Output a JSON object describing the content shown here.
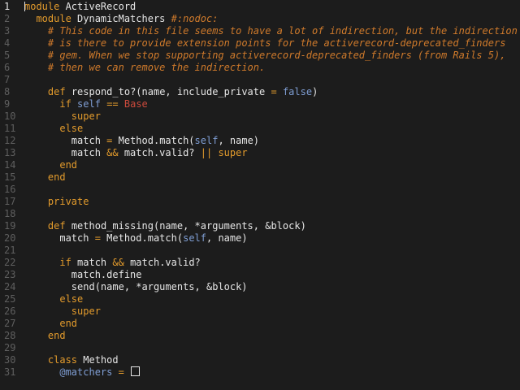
{
  "editor": {
    "current_line": 1,
    "colors": {
      "background": "#1c1c1c",
      "plain": "#e6e6e6",
      "keyword": "#e39b2c",
      "comment": "#cf7a2b",
      "constant": "#cc4a3c",
      "ivar": "#7f9ed4",
      "linenumber": "#5f5f5f",
      "linenumber_current": "#e6e6e6"
    },
    "lines": [
      {
        "n": "1",
        "tokens": [
          [
            "keyword",
            "module"
          ],
          [
            "plain",
            " ActiveRecord"
          ]
        ]
      },
      {
        "n": "2",
        "tokens": [
          [
            "plain",
            "  "
          ],
          [
            "keyword",
            "module"
          ],
          [
            "plain",
            " DynamicMatchers "
          ],
          [
            "comment",
            "#:nodoc:"
          ]
        ]
      },
      {
        "n": "3",
        "tokens": [
          [
            "plain",
            "    "
          ],
          [
            "comment",
            "# This code in this file seems to have a lot of indirection, but the indirection"
          ]
        ]
      },
      {
        "n": "4",
        "tokens": [
          [
            "plain",
            "    "
          ],
          [
            "comment",
            "# is there to provide extension points for the activerecord-deprecated_finders"
          ]
        ]
      },
      {
        "n": "5",
        "tokens": [
          [
            "plain",
            "    "
          ],
          [
            "comment",
            "# gem. When we stop supporting activerecord-deprecated_finders (from Rails 5),"
          ]
        ]
      },
      {
        "n": "6",
        "tokens": [
          [
            "plain",
            "    "
          ],
          [
            "comment",
            "# then we can remove the indirection."
          ]
        ]
      },
      {
        "n": "7",
        "tokens": []
      },
      {
        "n": "8",
        "tokens": [
          [
            "plain",
            "    "
          ],
          [
            "keyword",
            "def"
          ],
          [
            "plain",
            " respond_to?(name, include_private "
          ],
          [
            "keyword",
            "="
          ],
          [
            "plain",
            " "
          ],
          [
            "ivar",
            "false"
          ],
          [
            "plain",
            ")"
          ]
        ]
      },
      {
        "n": "9",
        "tokens": [
          [
            "plain",
            "      "
          ],
          [
            "keyword",
            "if"
          ],
          [
            "plain",
            " "
          ],
          [
            "ivar",
            "self"
          ],
          [
            "plain",
            " "
          ],
          [
            "keyword",
            "=="
          ],
          [
            "plain",
            " "
          ],
          [
            "constant",
            "Base"
          ]
        ]
      },
      {
        "n": "10",
        "tokens": [
          [
            "plain",
            "        "
          ],
          [
            "keyword",
            "super"
          ]
        ]
      },
      {
        "n": "11",
        "tokens": [
          [
            "plain",
            "      "
          ],
          [
            "keyword",
            "else"
          ]
        ]
      },
      {
        "n": "12",
        "tokens": [
          [
            "plain",
            "        match "
          ],
          [
            "keyword",
            "="
          ],
          [
            "plain",
            " Method.match("
          ],
          [
            "ivar",
            "self"
          ],
          [
            "plain",
            ", name)"
          ]
        ]
      },
      {
        "n": "13",
        "tokens": [
          [
            "plain",
            "        match "
          ],
          [
            "keyword",
            "&&"
          ],
          [
            "plain",
            " match.valid? "
          ],
          [
            "keyword",
            "||"
          ],
          [
            "plain",
            " "
          ],
          [
            "keyword",
            "super"
          ]
        ]
      },
      {
        "n": "14",
        "tokens": [
          [
            "plain",
            "      "
          ],
          [
            "keyword",
            "end"
          ]
        ]
      },
      {
        "n": "15",
        "tokens": [
          [
            "plain",
            "    "
          ],
          [
            "keyword",
            "end"
          ]
        ]
      },
      {
        "n": "16",
        "tokens": []
      },
      {
        "n": "17",
        "tokens": [
          [
            "plain",
            "    "
          ],
          [
            "keyword",
            "private"
          ]
        ]
      },
      {
        "n": "18",
        "tokens": []
      },
      {
        "n": "19",
        "tokens": [
          [
            "plain",
            "    "
          ],
          [
            "keyword",
            "def"
          ],
          [
            "plain",
            " method_missing(name, *arguments, &block)"
          ]
        ]
      },
      {
        "n": "20",
        "tokens": [
          [
            "plain",
            "      match "
          ],
          [
            "keyword",
            "="
          ],
          [
            "plain",
            " Method.match("
          ],
          [
            "ivar",
            "self"
          ],
          [
            "plain",
            ", name)"
          ]
        ]
      },
      {
        "n": "21",
        "tokens": []
      },
      {
        "n": "22",
        "tokens": [
          [
            "plain",
            "      "
          ],
          [
            "keyword",
            "if"
          ],
          [
            "plain",
            " match "
          ],
          [
            "keyword",
            "&&"
          ],
          [
            "plain",
            " match.valid?"
          ]
        ]
      },
      {
        "n": "23",
        "tokens": [
          [
            "plain",
            "        match.define"
          ]
        ]
      },
      {
        "n": "24",
        "tokens": [
          [
            "plain",
            "        send(name, *arguments, &block)"
          ]
        ]
      },
      {
        "n": "25",
        "tokens": [
          [
            "plain",
            "      "
          ],
          [
            "keyword",
            "else"
          ]
        ]
      },
      {
        "n": "26",
        "tokens": [
          [
            "plain",
            "        "
          ],
          [
            "keyword",
            "super"
          ]
        ]
      },
      {
        "n": "27",
        "tokens": [
          [
            "plain",
            "      "
          ],
          [
            "keyword",
            "end"
          ]
        ]
      },
      {
        "n": "28",
        "tokens": [
          [
            "plain",
            "    "
          ],
          [
            "keyword",
            "end"
          ]
        ]
      },
      {
        "n": "29",
        "tokens": []
      },
      {
        "n": "30",
        "tokens": [
          [
            "plain",
            "    "
          ],
          [
            "keyword",
            "class"
          ],
          [
            "plain",
            " Method"
          ]
        ]
      },
      {
        "n": "31",
        "tokens": [
          [
            "plain",
            "      "
          ],
          [
            "ivar",
            "@matchers"
          ],
          [
            "plain",
            " "
          ],
          [
            "keyword",
            "="
          ],
          [
            "plain",
            " "
          ],
          [
            "caret",
            ""
          ]
        ]
      }
    ]
  }
}
